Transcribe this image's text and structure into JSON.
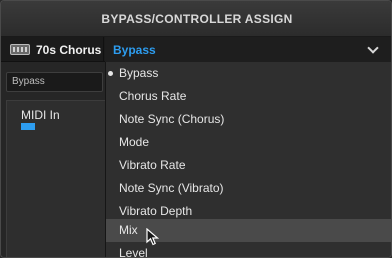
{
  "window": {
    "title": "BYPASS/CONTROLLER ASSIGN"
  },
  "block": {
    "icon": "effect-block-icon",
    "name": "70s Chorus"
  },
  "dropdown": {
    "selected": "Bypass",
    "icon": "chevron-down-icon"
  },
  "param_field": {
    "value": "Bypass"
  },
  "source": {
    "label": "MIDI In"
  },
  "colors": {
    "accent": "#2d9df0",
    "background": "#232323",
    "menu_bg": "#2f2f2f",
    "hover": "#4a4a4a"
  },
  "menu": {
    "items": [
      {
        "label": "Bypass",
        "checked": true
      },
      {
        "label": "Chorus Rate"
      },
      {
        "label": "Note Sync (Chorus)"
      },
      {
        "label": "Mode"
      },
      {
        "label": "Vibrato Rate"
      },
      {
        "label": "Note Sync (Vibrato)"
      },
      {
        "label": "Vibrato Depth"
      },
      {
        "label": "Mix",
        "hovered": true
      },
      {
        "label": "Level"
      }
    ]
  }
}
